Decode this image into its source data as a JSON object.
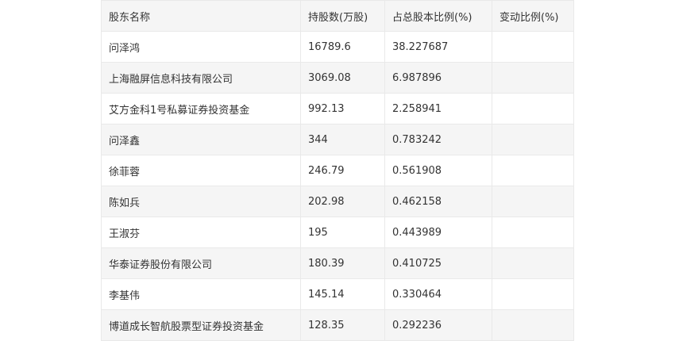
{
  "table": {
    "headers": [
      "股东名称",
      "持股数(万股)",
      "占总股本比例(%)",
      "变动比例(%)"
    ],
    "rows": [
      [
        "问泽鸿",
        "16789.6",
        "38.227687",
        ""
      ],
      [
        "上海融屏信息科技有限公司",
        "3069.08",
        "6.987896",
        ""
      ],
      [
        "艾方金科1号私募证券投资基金",
        "992.13",
        "2.258941",
        ""
      ],
      [
        "问泽鑫",
        "344",
        "0.783242",
        ""
      ],
      [
        "徐菲蓉",
        "246.79",
        "0.561908",
        ""
      ],
      [
        "陈如兵",
        "202.98",
        "0.462158",
        ""
      ],
      [
        "王淑芬",
        "195",
        "0.443989",
        ""
      ],
      [
        "华泰证券股份有限公司",
        "180.39",
        "0.410725",
        ""
      ],
      [
        "李基伟",
        "145.14",
        "0.330464",
        ""
      ],
      [
        "博道成长智航股票型证券投资基金",
        "128.35",
        "0.292236",
        ""
      ]
    ]
  }
}
